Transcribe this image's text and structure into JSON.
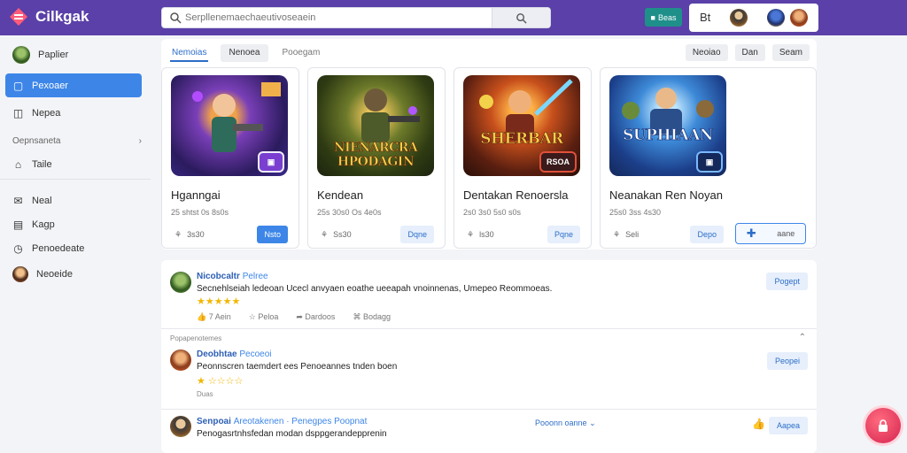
{
  "app": {
    "name": "Cilkgak"
  },
  "search": {
    "placeholder": "Serpllenemaechaeutivoseaein",
    "button_icon": "search-icon"
  },
  "topbar": {
    "teal_label": "Beas",
    "right_label": "Bt"
  },
  "sidebar": {
    "profile": "Paplier",
    "items": [
      {
        "label": "Pexoaer",
        "icon": "home-icon"
      },
      {
        "label": "Nepea",
        "icon": "chat-icon"
      }
    ],
    "section": "Oepnsaneta",
    "lower": [
      {
        "label": "Taile",
        "icon": "store-icon"
      },
      {
        "label": "Neal",
        "icon": "mail-icon"
      },
      {
        "label": "Kagp",
        "icon": "briefcase-icon"
      },
      {
        "label": "Penoedeate",
        "icon": "clock-icon"
      },
      {
        "label": "Neoeide",
        "icon": "user-icon"
      }
    ]
  },
  "tabs": [
    "Nemoias",
    "Nenoea",
    "Pooegam"
  ],
  "filters": [
    "Neoiao",
    "Dan",
    "Seam"
  ],
  "cards": [
    {
      "title": "Hganngai",
      "meta": "25 shtst 0s 8s0s",
      "stat": "3s30",
      "button": "Nsto",
      "badge": "▣",
      "art_text": ""
    },
    {
      "title": "Kendean",
      "meta": "25s 30s0 Os 4e0s",
      "stat": "Ss30",
      "button": "Dqne",
      "badge": "",
      "art_text": "NIENARCRA HPODAGIN"
    },
    {
      "title": "Dentakan Renoersla",
      "meta": "2s0 3s0 5s0 s0s",
      "stat": "ls30",
      "button": "Pqne",
      "badge": "RSOA",
      "art_text": "SHERBAR"
    },
    {
      "title": "Neanakan Ren Noyan",
      "meta": "25s0 3ss 4s30",
      "stat": "Seli",
      "button": "Depo",
      "button2": "aane",
      "badge": "▣",
      "art_text": "SUPHIAAN"
    }
  ],
  "posts": [
    {
      "author": "Nicobcaltr",
      "tag": "Pelree",
      "text": "Secnehlseiah ledeoan Ucecl anvyaen eoathe ueeapah vnoinnenas, Umepeo Reommoeas.",
      "stars": "★★★★★",
      "actions": [
        "7 Aein",
        "Peloa",
        "Dardoos",
        "Bodagg"
      ],
      "button": "Pogept"
    },
    {
      "section_label": "Popapenotemes",
      "author": "Deobhtae",
      "tag": "Pecoeoi",
      "text": "Peonnscren taemdert ees Penoeannes tnden boen",
      "stars": "★ ☆☆☆☆",
      "small": "Duas",
      "button": "Peopei"
    },
    {
      "author": "Senpoai",
      "tag": "Areotakenen",
      "tag2": "Penegpes",
      "tag3": "Poopnat",
      "text": "Penogasrtnhsfedan modan dsppgerandepprenin",
      "dropdown": "Pooonn oanne",
      "button": "Aapea"
    }
  ]
}
